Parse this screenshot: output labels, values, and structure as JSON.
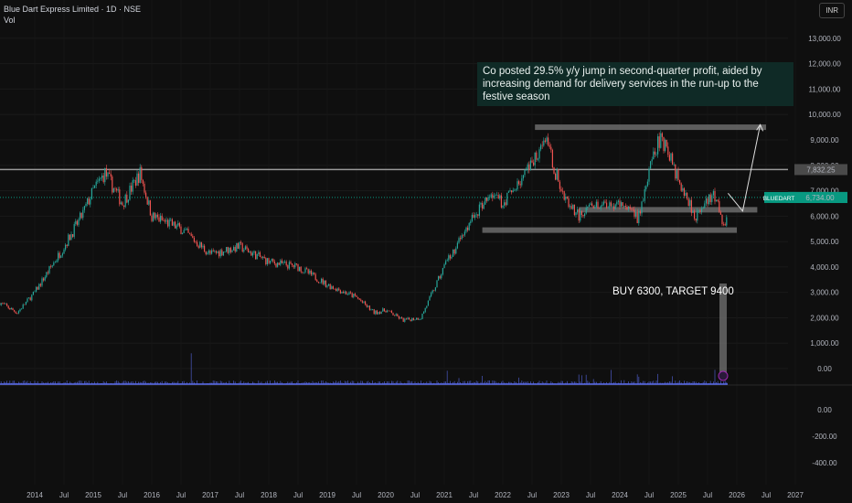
{
  "header": {
    "title": "Blue Dart Express Limited · 1D · NSE",
    "indicator": "Vol",
    "currency": "INR"
  },
  "annotations": {
    "note": "Co posted 29.5% y/y jump in second-quarter profit, aided by increasing demand for delivery services in the run-up to the festive season",
    "buy": "BUY 6300, TARGET 9400"
  },
  "chart_data": {
    "type": "candlestick",
    "title": "Blue Dart Express Limited · 1D · NSE",
    "symbol": "BLUEDART",
    "last_price": "6,734.00",
    "line_price": "7,832.25",
    "colors": {
      "up": "#26a69a",
      "down": "#ef5350",
      "label": "#089981",
      "volume": "#5b6cf0"
    },
    "y_ticks": [
      "13,000.00",
      "12,000.00",
      "11,000.00",
      "10,000.00",
      "9,000.00",
      "8,000.00",
      "7,000.00",
      "6,000.00",
      "5,000.00",
      "4,000.00",
      "3,000.00",
      "2,000.00",
      "1,000.00",
      "0.00"
    ],
    "y_tick_values": [
      13000,
      12000,
      11000,
      10000,
      9000,
      8000,
      7000,
      6000,
      5000,
      4000,
      3000,
      2000,
      1000,
      0
    ],
    "vol_ticks": [
      "0.00",
      "-200.00",
      "-400.00"
    ],
    "x_ticks": [
      "2014",
      "Jul",
      "2015",
      "Jul",
      "2016",
      "Jul",
      "2017",
      "Jul",
      "2018",
      "Jul",
      "2019",
      "Jul",
      "2020",
      "Jul",
      "2021",
      "Jul",
      "2022",
      "Jul",
      "2023",
      "Jul",
      "2024",
      "Jul",
      "2025",
      "Jul",
      "2026",
      "Jul",
      "2027"
    ],
    "x_tick_years": [
      2014,
      2014.5,
      2015,
      2015.5,
      2016,
      2016.5,
      2017,
      2017.5,
      2018,
      2018.5,
      2019,
      2019.5,
      2020,
      2020.5,
      2021,
      2021.5,
      2022,
      2022.5,
      2023,
      2023.5,
      2024,
      2024.5,
      2025,
      2025.5,
      2026,
      2026.5,
      2027
    ],
    "price_path": [
      [
        2013.4,
        2600
      ],
      [
        2013.7,
        2200
      ],
      [
        2014.0,
        3000
      ],
      [
        2014.5,
        4800
      ],
      [
        2014.8,
        6000
      ],
      [
        2015.0,
        7000
      ],
      [
        2015.2,
        7700
      ],
      [
        2015.5,
        6500
      ],
      [
        2015.8,
        7700
      ],
      [
        2016.0,
        6000
      ],
      [
        2016.5,
        5500
      ],
      [
        2017.0,
        4500
      ],
      [
        2017.5,
        4800
      ],
      [
        2018.0,
        4200
      ],
      [
        2018.5,
        4000
      ],
      [
        2019.0,
        3300
      ],
      [
        2019.5,
        2800
      ],
      [
        2019.8,
        2200
      ],
      [
        2020.0,
        2300
      ],
      [
        2020.3,
        1900
      ],
      [
        2020.6,
        2000
      ],
      [
        2021.0,
        4000
      ],
      [
        2021.5,
        6000
      ],
      [
        2021.8,
        6800
      ],
      [
        2022.0,
        6500
      ],
      [
        2022.5,
        8000
      ],
      [
        2022.7,
        9200
      ],
      [
        2023.0,
        7000
      ],
      [
        2023.3,
        6000
      ],
      [
        2023.6,
        6500
      ],
      [
        2024.0,
        6500
      ],
      [
        2024.3,
        5900
      ],
      [
        2024.6,
        8500
      ],
      [
        2024.7,
        9200
      ],
      [
        2025.0,
        7500
      ],
      [
        2025.3,
        6000
      ],
      [
        2025.6,
        6800
      ],
      [
        2025.8,
        5600
      ],
      [
        2025.85,
        6734
      ]
    ],
    "zones": [
      {
        "from": 2022.55,
        "to": 2026.5,
        "price": 9500
      },
      {
        "from": 2023.3,
        "to": 2026.35,
        "price": 6250
      },
      {
        "from": 2021.65,
        "to": 2026.0,
        "price": 5450
      }
    ],
    "projection": [
      [
        2025.85,
        6900
      ],
      [
        2026.1,
        6200
      ],
      [
        2026.4,
        9600
      ]
    ]
  }
}
